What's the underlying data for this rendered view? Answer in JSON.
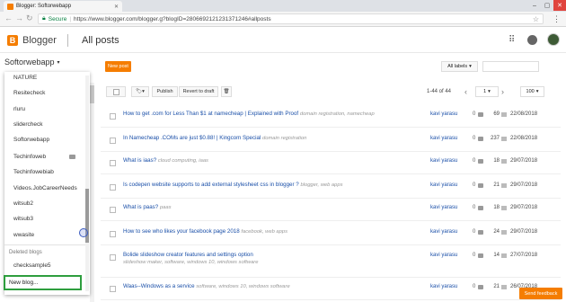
{
  "browser": {
    "tab_title": "Blogger: Softorwebapp",
    "secure_label": "Secure",
    "url": "https://www.blogger.com/blogger.g?blogID=2806692121231371246#allposts"
  },
  "header": {
    "app_name": "Blogger",
    "page_title": "All posts"
  },
  "toolbar": {
    "blog_selector": "Softorwebapp",
    "new_post": "New post",
    "all_labels": "All labels",
    "publish": "Publish",
    "revert": "Revert to draft",
    "page_count": "1-44 of 44",
    "page_number": "1",
    "per_page": "100"
  },
  "blog_menu": {
    "items": [
      "NATURE",
      "Resitecheck",
      "rluru",
      "slidercheck",
      "Softorwebapp",
      "Techinfoweb",
      "Techinfowebiab",
      "Videos.JobCareerNeeds",
      "witsub2",
      "witsub3",
      "wwasite"
    ],
    "deleted_heading": "Deleted blogs",
    "deleted_items": [
      "checksample5"
    ],
    "new_blog": "New blog..."
  },
  "posts": [
    {
      "title": "How to get .com for Less Than $1 at namecheap | Explained with Proof",
      "labels": "domain registration, namecheap",
      "sub": "",
      "author": "kavi yarasu",
      "comments": "0",
      "views": "69",
      "date": "22/08/2018"
    },
    {
      "title": "In Namecheap .COMs are just $0.88! | Kingcom Special",
      "labels": "domain registration",
      "sub": "",
      "author": "kavi yarasu",
      "comments": "0",
      "views": "237",
      "date": "22/08/2018"
    },
    {
      "title": "What is iaas?",
      "labels": "cloud computing, iaas",
      "sub": "",
      "author": "kavi yarasu",
      "comments": "0",
      "views": "18",
      "date": "29/07/2018"
    },
    {
      "title": "Is codepen website supports to add external stylesheet css in blogger ?",
      "labels": "blogger, web apps",
      "sub": "",
      "author": "kavi yarasu",
      "comments": "0",
      "views": "21",
      "date": "29/07/2018"
    },
    {
      "title": "What is paas?",
      "labels": "paas",
      "sub": "",
      "author": "kavi yarasu",
      "comments": "0",
      "views": "18",
      "date": "29/07/2018"
    },
    {
      "title": "How to see who likes your facebook page 2018",
      "labels": "facebook, web apps",
      "sub": "",
      "author": "kavi yarasu",
      "comments": "0",
      "views": "24",
      "date": "29/07/2018"
    },
    {
      "title": "Bolide slideshow creator features and settings option",
      "labels": "",
      "sub": "slideshow maker, software, windows 10, windows software",
      "author": "kavi yarasu",
      "comments": "0",
      "views": "14",
      "date": "27/07/2018"
    },
    {
      "title": "Waas--Windows as a service",
      "labels": "software, windows 10, windows software",
      "sub": "",
      "author": "kavi yarasu",
      "comments": "0",
      "views": "21",
      "date": "26/07/2018"
    }
  ],
  "footer": {
    "feedback": "Send feedback"
  }
}
